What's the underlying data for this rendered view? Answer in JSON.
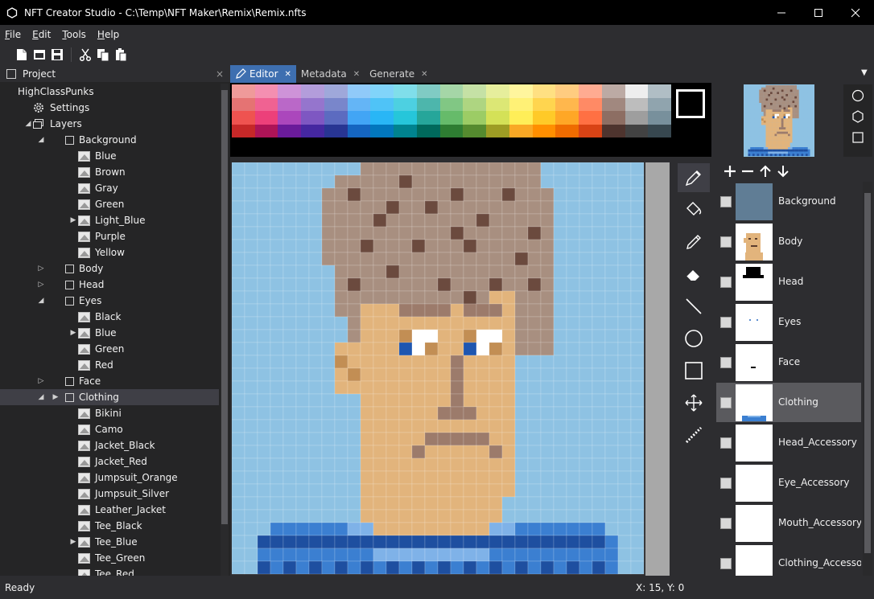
{
  "window": {
    "title": "NFT Creator Studio - C:\\Temp\\NFT Maker\\Remix\\Remix.nfts",
    "minimize_icon": "minimize-icon",
    "maximize_icon": "maximize-icon",
    "close_icon": "close-icon"
  },
  "menu": {
    "items": [
      {
        "first": "F",
        "rest": "ile"
      },
      {
        "first": "E",
        "rest": "dit"
      },
      {
        "first": "T",
        "rest": "ools"
      },
      {
        "first": "H",
        "rest": "elp"
      }
    ]
  },
  "toolbar": {
    "buttons": [
      "new-file-icon",
      "open-file-icon",
      "save-icon",
      "cut-icon",
      "copy-icon",
      "paste-icon"
    ]
  },
  "project": {
    "title": "Project",
    "close": "×",
    "tree": [
      {
        "label": "HighClassPunks",
        "level": 0,
        "arrow": "",
        "icon": "none"
      },
      {
        "label": "Settings",
        "level": 1,
        "arrow": "",
        "icon": "gear"
      },
      {
        "label": "Layers",
        "level": 1,
        "arrow": "◢",
        "icon": "layers"
      },
      {
        "label": "Background",
        "level": 2,
        "arrow": "◢",
        "icon": "folder"
      },
      {
        "label": "Blue",
        "level": 3,
        "arrow": "",
        "icon": "image"
      },
      {
        "label": "Brown",
        "level": 3,
        "arrow": "",
        "icon": "image"
      },
      {
        "label": "Gray",
        "level": 3,
        "arrow": "",
        "icon": "image"
      },
      {
        "label": "Green",
        "level": 3,
        "arrow": "",
        "icon": "image"
      },
      {
        "label": "Light_Blue",
        "level": 3,
        "arrow": "▶",
        "icon": "image"
      },
      {
        "label": "Purple",
        "level": 3,
        "arrow": "",
        "icon": "image"
      },
      {
        "label": "Yellow",
        "level": 3,
        "arrow": "",
        "icon": "image"
      },
      {
        "label": "Body",
        "level": 2,
        "arrow": "▷",
        "icon": "folder"
      },
      {
        "label": "Head",
        "level": 2,
        "arrow": "▷",
        "icon": "folder"
      },
      {
        "label": "Eyes",
        "level": 2,
        "arrow": "◢",
        "icon": "folder"
      },
      {
        "label": "Black",
        "level": 3,
        "arrow": "",
        "icon": "image"
      },
      {
        "label": "Blue",
        "level": 3,
        "arrow": "▶",
        "icon": "image"
      },
      {
        "label": "Green",
        "level": 3,
        "arrow": "",
        "icon": "image"
      },
      {
        "label": "Red",
        "level": 3,
        "arrow": "",
        "icon": "image"
      },
      {
        "label": "Face",
        "level": 2,
        "arrow": "▷",
        "icon": "folder"
      },
      {
        "label": "Clothing",
        "level": 2,
        "arrow": "◢",
        "icon": "folder",
        "selected": true,
        "pointer": "▶"
      },
      {
        "label": "Bikini",
        "level": 3,
        "arrow": "",
        "icon": "image"
      },
      {
        "label": "Camo",
        "level": 3,
        "arrow": "",
        "icon": "image"
      },
      {
        "label": "Jacket_Black",
        "level": 3,
        "arrow": "",
        "icon": "image"
      },
      {
        "label": "Jacket_Red",
        "level": 3,
        "arrow": "",
        "icon": "image"
      },
      {
        "label": "Jumpsuit_Orange",
        "level": 3,
        "arrow": "",
        "icon": "image"
      },
      {
        "label": "Jumpsuit_Silver",
        "level": 3,
        "arrow": "",
        "icon": "image"
      },
      {
        "label": "Leather_Jacket",
        "level": 3,
        "arrow": "",
        "icon": "image"
      },
      {
        "label": "Tee_Black",
        "level": 3,
        "arrow": "",
        "icon": "image"
      },
      {
        "label": "Tee_Blue",
        "level": 3,
        "arrow": "▶",
        "icon": "image"
      },
      {
        "label": "Tee_Green",
        "level": 3,
        "arrow": "",
        "icon": "image"
      },
      {
        "label": "Tee_Red",
        "level": 3,
        "arrow": "",
        "icon": "image"
      }
    ]
  },
  "tabs": [
    {
      "label": "Editor",
      "active": true,
      "icon": "pencil-icon",
      "close": "✕"
    },
    {
      "label": "Metadata",
      "active": false,
      "close": "✕"
    },
    {
      "label": "Generate",
      "active": false,
      "close": "✕"
    }
  ],
  "tab_dropdown": "▼",
  "palette": {
    "columns": [
      [
        "#ef9a9a",
        "#e57373",
        "#ef5350",
        "#c62828"
      ],
      [
        "#f48fb1",
        "#f06292",
        "#ec407a",
        "#ad1457"
      ],
      [
        "#ce93d8",
        "#ba68c8",
        "#ab47bc",
        "#6a1b9a"
      ],
      [
        "#b39ddb",
        "#9575cd",
        "#7e57c2",
        "#4527a0"
      ],
      [
        "#9fa8da",
        "#7986cb",
        "#5c6bc0",
        "#283593"
      ],
      [
        "#90caf9",
        "#64b5f6",
        "#42a5f5",
        "#1565c0"
      ],
      [
        "#81d4fa",
        "#4fc3f7",
        "#29b6f6",
        "#0277bd"
      ],
      [
        "#80deea",
        "#4dd0e1",
        "#26c6da",
        "#00838f"
      ],
      [
        "#80cbc4",
        "#4db6ac",
        "#26a69a",
        "#00695c"
      ],
      [
        "#a5d6a7",
        "#81c784",
        "#66bb6a",
        "#2e7d32"
      ],
      [
        "#c5e1a5",
        "#aed581",
        "#9ccc65",
        "#558b2f"
      ],
      [
        "#e6ee9c",
        "#dce775",
        "#d4e157",
        "#9e9d24"
      ],
      [
        "#fff59d",
        "#fff176",
        "#ffee58",
        "#f9a825"
      ],
      [
        "#ffe082",
        "#ffd54f",
        "#ffca28",
        "#ff8f00"
      ],
      [
        "#ffcc80",
        "#ffb74d",
        "#ffa726",
        "#ef6c00"
      ],
      [
        "#ffab91",
        "#ff8a65",
        "#ff7043",
        "#d84315"
      ],
      [
        "#bcaaa4",
        "#a1887f",
        "#8d6e63",
        "#4e342e"
      ],
      [
        "#eeeeee",
        "#bdbdbd",
        "#9e9e9e",
        "#424242"
      ],
      [
        "#b0bec5",
        "#90a4ae",
        "#78909c",
        "#37474f"
      ]
    ],
    "current_color": "#000000"
  },
  "tools": [
    {
      "name": "pencil-tool",
      "icon": "pencil-icon",
      "active": true
    },
    {
      "name": "fill-tool",
      "icon": "paint-bucket-icon"
    },
    {
      "name": "eyedropper-tool",
      "icon": "eyedropper-icon"
    },
    {
      "name": "eraser-tool",
      "icon": "eraser-icon"
    },
    {
      "name": "line-tool",
      "icon": "line-icon"
    },
    {
      "name": "ellipse-tool",
      "icon": "circle-icon"
    },
    {
      "name": "rectangle-tool",
      "icon": "square-icon"
    },
    {
      "name": "move-tool",
      "icon": "move-icon"
    },
    {
      "name": "dotted-line-tool",
      "icon": "dotted-line-icon"
    }
  ],
  "shape_buttons": [
    "circle-icon",
    "hexagon-icon",
    "square-icon"
  ],
  "layer_actions": [
    "add-icon",
    "remove-icon",
    "move-up-icon",
    "move-down-icon"
  ],
  "layers": [
    {
      "name": "Background",
      "thumb": "background",
      "selected": false
    },
    {
      "name": "Body",
      "thumb": "body",
      "selected": false
    },
    {
      "name": "Head",
      "thumb": "head",
      "selected": false
    },
    {
      "name": "Eyes",
      "thumb": "eyes",
      "selected": false
    },
    {
      "name": "Face",
      "thumb": "face",
      "selected": false
    },
    {
      "name": "Clothing",
      "thumb": "clothing",
      "selected": true
    },
    {
      "name": "Head_Accessory",
      "thumb": "blank",
      "selected": false
    },
    {
      "name": "Eye_Accessory",
      "thumb": "blank",
      "selected": false
    },
    {
      "name": "Mouth_Accessory",
      "thumb": "blank",
      "selected": false
    },
    {
      "name": "Clothing_Accessory",
      "thumb": "blank",
      "selected": false
    }
  ],
  "colors": {
    "sky": "#8ec2e3",
    "hair": "#a88f80",
    "hair_dark": "#6b4a3e",
    "skin": "#e2b47c",
    "skin_shade": "#c28e54",
    "eye_white": "#ffffff",
    "eye_blue": "#1e56b0",
    "shirt": "#3b7fd1",
    "shirt_dark": "#1e4fa0",
    "shirt_light": "#7fb2e8",
    "feature": "#9c7b6b",
    "accent": "#3e6fb0"
  },
  "status": {
    "text": "Ready",
    "coords": "X: 15, Y: 0"
  }
}
